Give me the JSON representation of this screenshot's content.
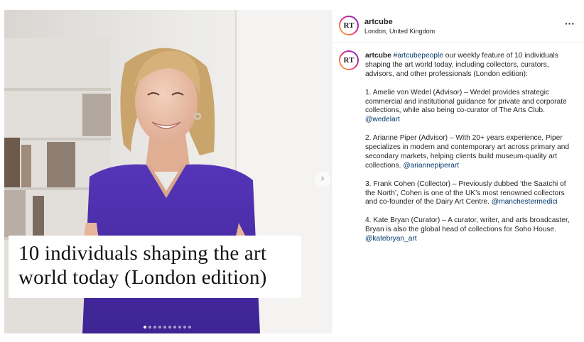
{
  "post": {
    "overlay_text": "10 individuals shaping the art world today (London edition)",
    "carousel": {
      "total": 10,
      "active": 1
    },
    "next_icon": "chevron-right-icon"
  },
  "header": {
    "avatar_monogram": "RT",
    "username": "artcube",
    "location": "London, United Kingdom",
    "more_icon": "ellipsis-icon",
    "more_label": "···"
  },
  "caption": {
    "username": "artcube",
    "hashtag": "#artcubepeople",
    "intro": " our weekly feature of 10 individuals shaping the art world today, including collectors, curators, advisors, and other professionals (London edition):",
    "items": [
      {
        "text": "1. Amelie von Wedel (Advisor) – Wedel provides strategic commercial and institutional guidance for private and corporate collections, while also being co-curator of The Arts Club. ",
        "handle": "@wedelart"
      },
      {
        "text": "2. Arianne Piper (Advisor) – With 20+ years experience, Piper specializes in modern and contemporary art across primary and secondary markets, helping clients build museum-quality art collections. ",
        "handle": "@ariannepiperart"
      },
      {
        "text": "3. Frank Cohen (Collector) – Previously dubbed ‘the Saatchi of the North’, Cohen is one of the UK’s most renowned collectors and co-founder of the Dairy Art Centre. ",
        "handle": "@manchestermedici"
      },
      {
        "text": "4. Kate Bryan (Curator) – A curator, writer, and arts broadcaster, Bryan is also the global head of collections for Soho House. ",
        "handle": "@katebryan_art"
      }
    ]
  },
  "colors": {
    "hashtag": "#00376b",
    "text": "#262626",
    "dress": "#4b2fa6"
  }
}
